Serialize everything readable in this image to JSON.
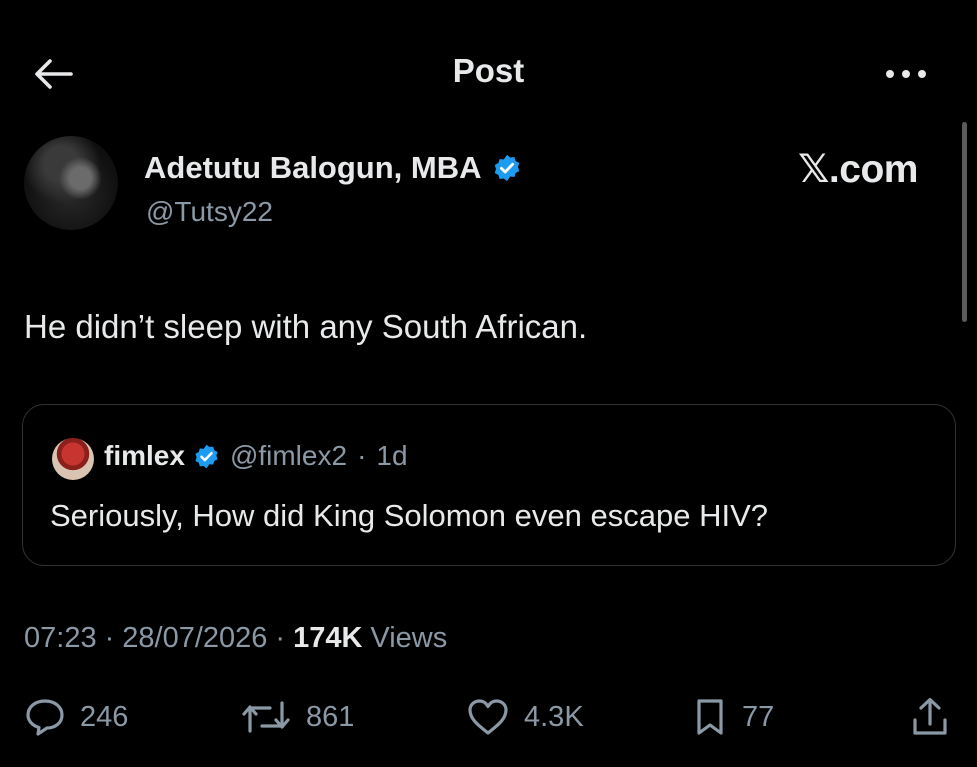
{
  "header": {
    "title": "Post"
  },
  "author": {
    "name": "Adetutu Balogun, MBA",
    "handle": "@Tutsy22"
  },
  "watermark": "𝕏.com",
  "post": {
    "text": "He didn’t sleep with any South African."
  },
  "quote": {
    "name": "fimlex",
    "handle": "@fimlex2",
    "sep": "·",
    "age": "1d",
    "text": "Seriously, How did King Solomon even escape HIV?"
  },
  "meta": {
    "time": "07:23",
    "dot1": "·",
    "date": "28/07/2026",
    "dot2": "·",
    "views_count": "174K",
    "views_label": "Views"
  },
  "actions": {
    "replies": "246",
    "reposts": "861",
    "likes": "4.3K",
    "bookmarks": "77"
  },
  "colors": {
    "background": "#000000",
    "text": "#e7e9ea",
    "muted": "#8b98a5",
    "verified": "#1d9bf0",
    "border": "#2f3336"
  },
  "icons": [
    "back-arrow-icon",
    "more-icon",
    "verified-badge-icon",
    "reply-icon",
    "repost-icon",
    "like-icon",
    "bookmark-icon",
    "share-icon"
  ]
}
